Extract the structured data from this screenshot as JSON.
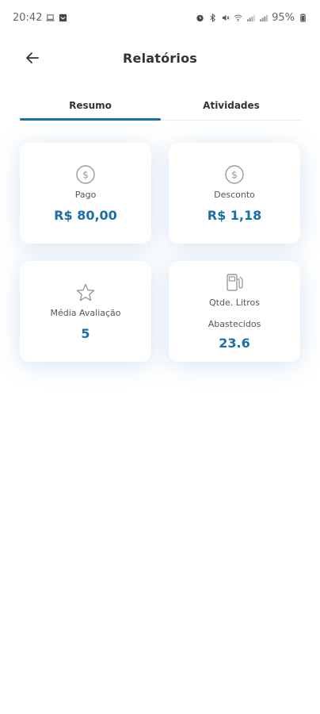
{
  "status_bar": {
    "time": "20:42",
    "battery": "95%"
  },
  "header": {
    "title": "Relatórios",
    "back_icon": "arrow-left-icon"
  },
  "tabs": [
    {
      "label": "Resumo",
      "active": true
    },
    {
      "label": "Atividades",
      "active": false
    }
  ],
  "cards": {
    "pago": {
      "icon": "dollar-circle-icon",
      "label": "Pago",
      "value": "R$ 80,00"
    },
    "desconto": {
      "icon": "dollar-circle-icon",
      "label": "Desconto",
      "value": "R$ 1,18"
    },
    "media": {
      "icon": "star-icon",
      "label": "Média Avaliação",
      "value": "5"
    },
    "litros": {
      "icon": "fuel-pump-icon",
      "label_line1": "Qtde. Litros",
      "label_line2": "Abastecidos",
      "value": "23.6"
    }
  },
  "colors": {
    "accent": "#1a6fa8",
    "text": "#333333",
    "icon": "#9a9a9a"
  }
}
